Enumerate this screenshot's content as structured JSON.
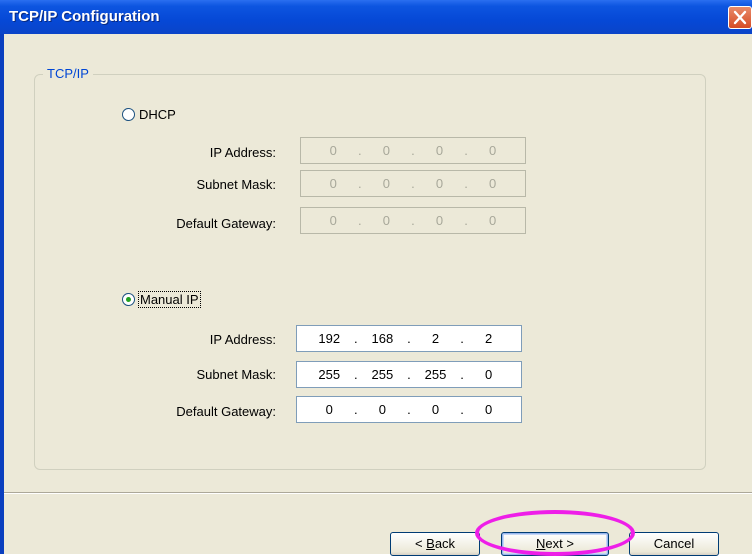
{
  "window": {
    "title": "TCP/IP Configuration"
  },
  "group": {
    "legend": "TCP/IP"
  },
  "dhcp": {
    "label": "DHCP",
    "selected": false,
    "fields": [
      {
        "label": "IP Address:",
        "octets": [
          "0",
          "0",
          "0",
          "0"
        ]
      },
      {
        "label": "Subnet Mask:",
        "octets": [
          "0",
          "0",
          "0",
          "0"
        ]
      },
      {
        "label": "Default Gateway:",
        "octets": [
          "0",
          "0",
          "0",
          "0"
        ]
      }
    ]
  },
  "manual": {
    "label": "Manual IP",
    "selected": true,
    "fields": [
      {
        "label": "IP Address:",
        "octets": [
          "192",
          "168",
          "2",
          "2"
        ]
      },
      {
        "label": "Subnet Mask:",
        "octets": [
          "255",
          "255",
          "255",
          "0"
        ]
      },
      {
        "label": "Default Gateway:",
        "octets": [
          "0",
          "0",
          "0",
          "0"
        ]
      }
    ]
  },
  "buttons": {
    "back": {
      "mnemonic": "B",
      "rest": "ack",
      "prefix": "< "
    },
    "next": {
      "mnemonic": "N",
      "rest": "ext >"
    },
    "cancel": "Cancel"
  },
  "colors": {
    "titlebar": "#0648d6",
    "dialog_bg": "#ece9d8",
    "group_legend": "#0046d5",
    "radio_dot": "#21a121",
    "highlight": "#ee1ee8"
  },
  "icons": {
    "close": "close-icon"
  }
}
